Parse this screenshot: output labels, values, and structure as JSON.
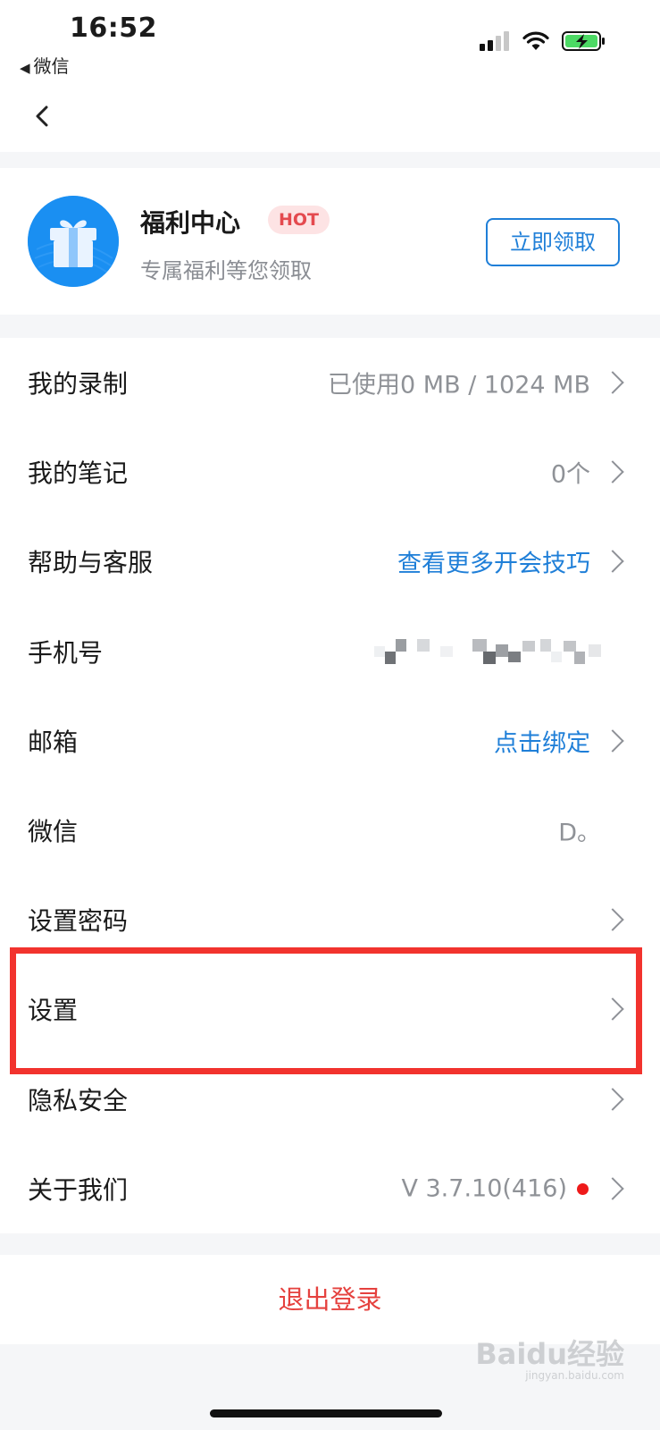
{
  "status_bar": {
    "time": "16:52",
    "back_app": "微信",
    "icons": [
      "cellular-signal-icon",
      "wifi-icon",
      "battery-charging-icon"
    ]
  },
  "nav": {
    "back_icon": "chevron-left-icon"
  },
  "welfare": {
    "title": "福利中心",
    "badge": "HOT",
    "subtitle": "专属福利等您领取",
    "button": "立即领取",
    "icon": "gift-icon"
  },
  "menu": {
    "items": [
      {
        "label": "我的录制",
        "value": "已使用0 MB / 1024 MB"
      },
      {
        "label": "我的笔记",
        "value": "0个"
      },
      {
        "label": "帮助与客服",
        "value": "查看更多开会技巧"
      },
      {
        "label": "手机号",
        "value": ""
      },
      {
        "label": "邮箱",
        "value": "点击绑定"
      },
      {
        "label": "微信",
        "value": "D。"
      },
      {
        "label": "设置密码",
        "value": ""
      },
      {
        "label": "设置",
        "value": ""
      },
      {
        "label": "隐私安全",
        "value": ""
      },
      {
        "label": "关于我们",
        "value": "V 3.7.10(416)"
      }
    ]
  },
  "logout": {
    "label": "退出登录"
  },
  "watermark": {
    "text": "Baidu经验",
    "sub": "jingyan.baidu.com"
  },
  "colors": {
    "accent_blue": "#1f7fd8",
    "danger_red": "#e5413e",
    "hot_bg": "#fde3e4",
    "highlight_red": "#f2332e",
    "battery_green": "#4cd964"
  }
}
